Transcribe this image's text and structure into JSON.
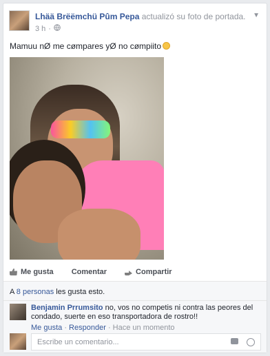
{
  "post": {
    "author": "Lhää Brëëmchü Pûm Pepa",
    "action": "actualizó su foto de portada.",
    "time": "3 h",
    "audience_icon": "globe-icon",
    "text": "Mamuu nØ me cømpares yØ no cømpiito"
  },
  "actions": {
    "like": "Me gusta",
    "comment": "Comentar",
    "share": "Compartir"
  },
  "likes": {
    "prefix": "A",
    "link": "8 personas",
    "suffix": "les gusta esto."
  },
  "comment": {
    "author": "Benjamin Prrumsito",
    "text": "no, vos no competis ni contra las peores del condado, suerte en eso transportadora de rostro!!",
    "like_link": "Me gusta",
    "reply_link": "Responder",
    "time": "Hace un momento"
  },
  "reply_box": {
    "placeholder": "Escribe un comentario..."
  }
}
